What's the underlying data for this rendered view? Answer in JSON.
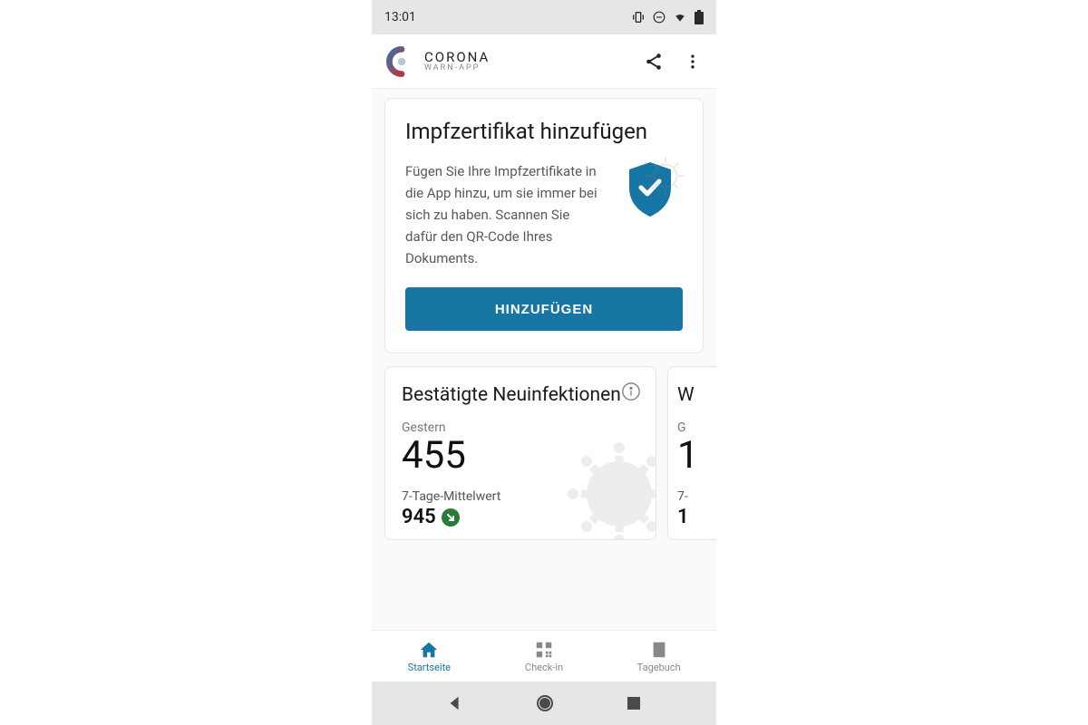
{
  "status": {
    "time": "13:01"
  },
  "app": {
    "title": "CORONA",
    "subtitle": "WARN-APP"
  },
  "cert_card": {
    "title": "Impfzertifikat hinzufügen",
    "description": "Fügen Sie Ihre Impfzertifikate in die App hinzu, um sie immer bei sich zu haben. Scannen Sie dafür den QR-Code Ihres Dokuments.",
    "button": "HINZUFÜGEN"
  },
  "stats": {
    "card1": {
      "title": "Bestätigte Neuinfektionen",
      "label": "Gestern",
      "value": "455",
      "sublabel": "7-Tage-Mittelwert",
      "subvalue": "945"
    },
    "card2": {
      "title_first_char": "W",
      "label_first_char": "G",
      "value_first_char": "1",
      "sublabel_first_chars": "7-",
      "subvalue_first_char": "1"
    }
  },
  "nav": {
    "home": "Startseite",
    "checkin": "Check-in",
    "diary": "Tagebuch"
  },
  "colors": {
    "primary": "#1776a3",
    "trend_down": "#2a7a3a"
  }
}
